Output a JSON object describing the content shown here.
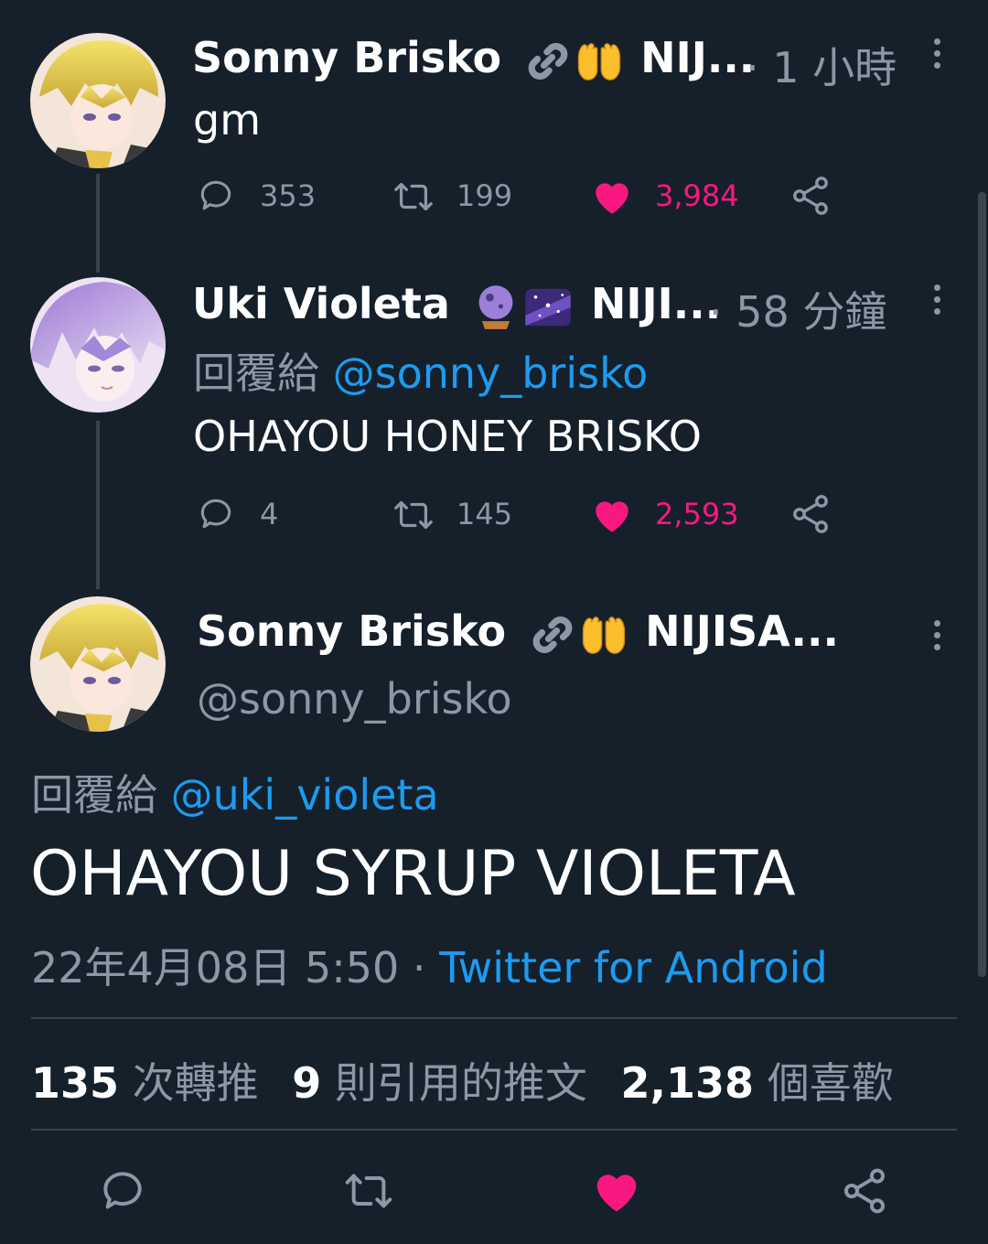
{
  "tweets": [
    {
      "name": "Sonny Brisko",
      "name_suffix": "NIJ...",
      "dot_time": "· 1 小時",
      "text": "gm",
      "replies": "353",
      "retweets": "199",
      "likes": "3,984"
    },
    {
      "name": "Uki Violeta",
      "name_suffix": "NIJI...",
      "dot_time": "· 58 分鐘",
      "reply_prefix": "回覆給",
      "reply_handle": "@sonny_brisko",
      "text": "OHAYOU HONEY BRISKO",
      "replies": "4",
      "retweets": "145",
      "likes": "2,593"
    }
  ],
  "main": {
    "name": "Sonny Brisko",
    "name_suffix": "NIJISA...",
    "handle": "@sonny_brisko",
    "reply_prefix": "回覆給",
    "reply_handle": "@uki_violeta",
    "text": "OHAYOU SYRUP VIOLETA",
    "date": "22年4月08日 5:50",
    "sep": "·",
    "source": "Twitter for Android",
    "stats": {
      "retweets_count": "135",
      "retweets_label": "次轉推",
      "quotes_count": "9",
      "quotes_label": "則引用的推文",
      "likes_count": "2,138",
      "likes_label": "個喜歡"
    }
  },
  "icons": {
    "reply": "reply-icon",
    "retweet": "retweet-icon",
    "like": "heart-icon",
    "share": "share-icon",
    "more": "more-vertical-icon",
    "link": "link-emoji",
    "hands": "raising-hands-emoji",
    "crystal_ball": "crystal-ball-emoji",
    "milky_way": "milky-way-emoji"
  },
  "colors": {
    "background": "#15202b",
    "muted": "#8b98a5",
    "accent": "#1d9bf0",
    "like": "#f91880"
  }
}
